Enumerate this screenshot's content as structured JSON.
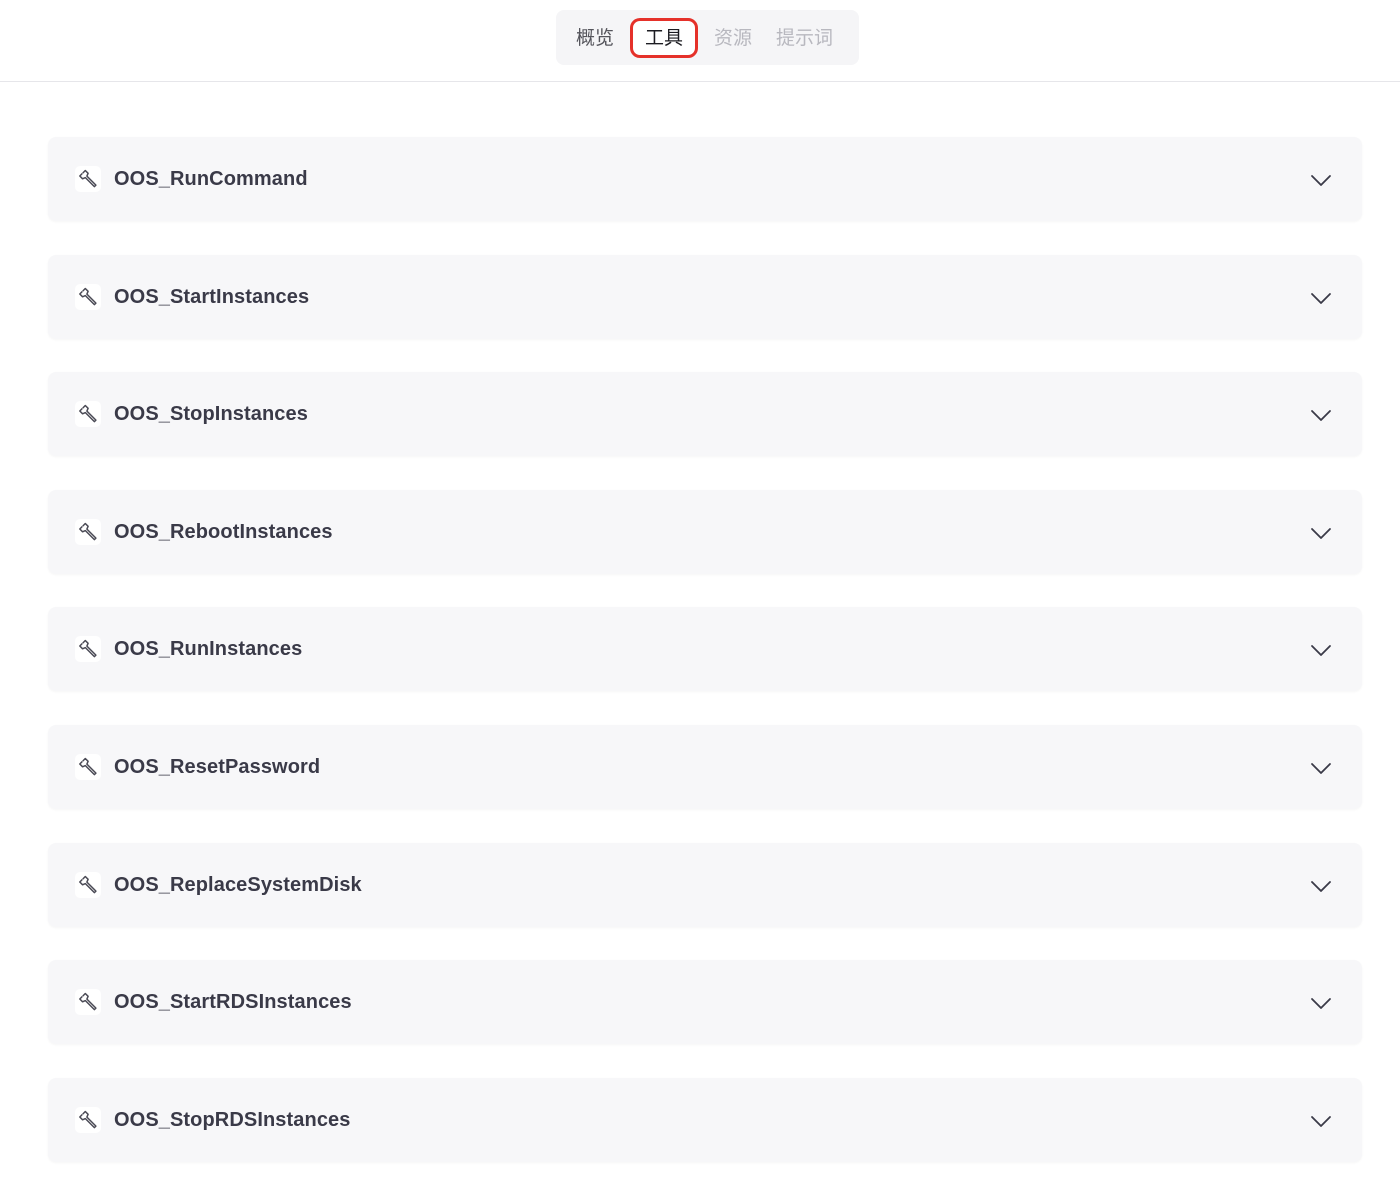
{
  "tabs": [
    {
      "label": "概览",
      "state": "inactive"
    },
    {
      "label": "工具",
      "state": "active"
    },
    {
      "label": "资源",
      "state": "disabled"
    },
    {
      "label": "提示词",
      "state": "disabled"
    }
  ],
  "tools": [
    {
      "name": "OOS_RunCommand"
    },
    {
      "name": "OOS_StartInstances"
    },
    {
      "name": "OOS_StopInstances"
    },
    {
      "name": "OOS_RebootInstances"
    },
    {
      "name": "OOS_RunInstances"
    },
    {
      "name": "OOS_ResetPassword"
    },
    {
      "name": "OOS_ReplaceSystemDisk"
    },
    {
      "name": "OOS_StartRDSInstances"
    },
    {
      "name": "OOS_StopRDSInstances"
    }
  ],
  "icons": {
    "tool": "wrench-icon",
    "expand": "chevron-down-icon"
  },
  "colors": {
    "active_tab_outline": "#e5312a",
    "item_background": "#f7f7f9",
    "label_text": "#3a3a48"
  }
}
